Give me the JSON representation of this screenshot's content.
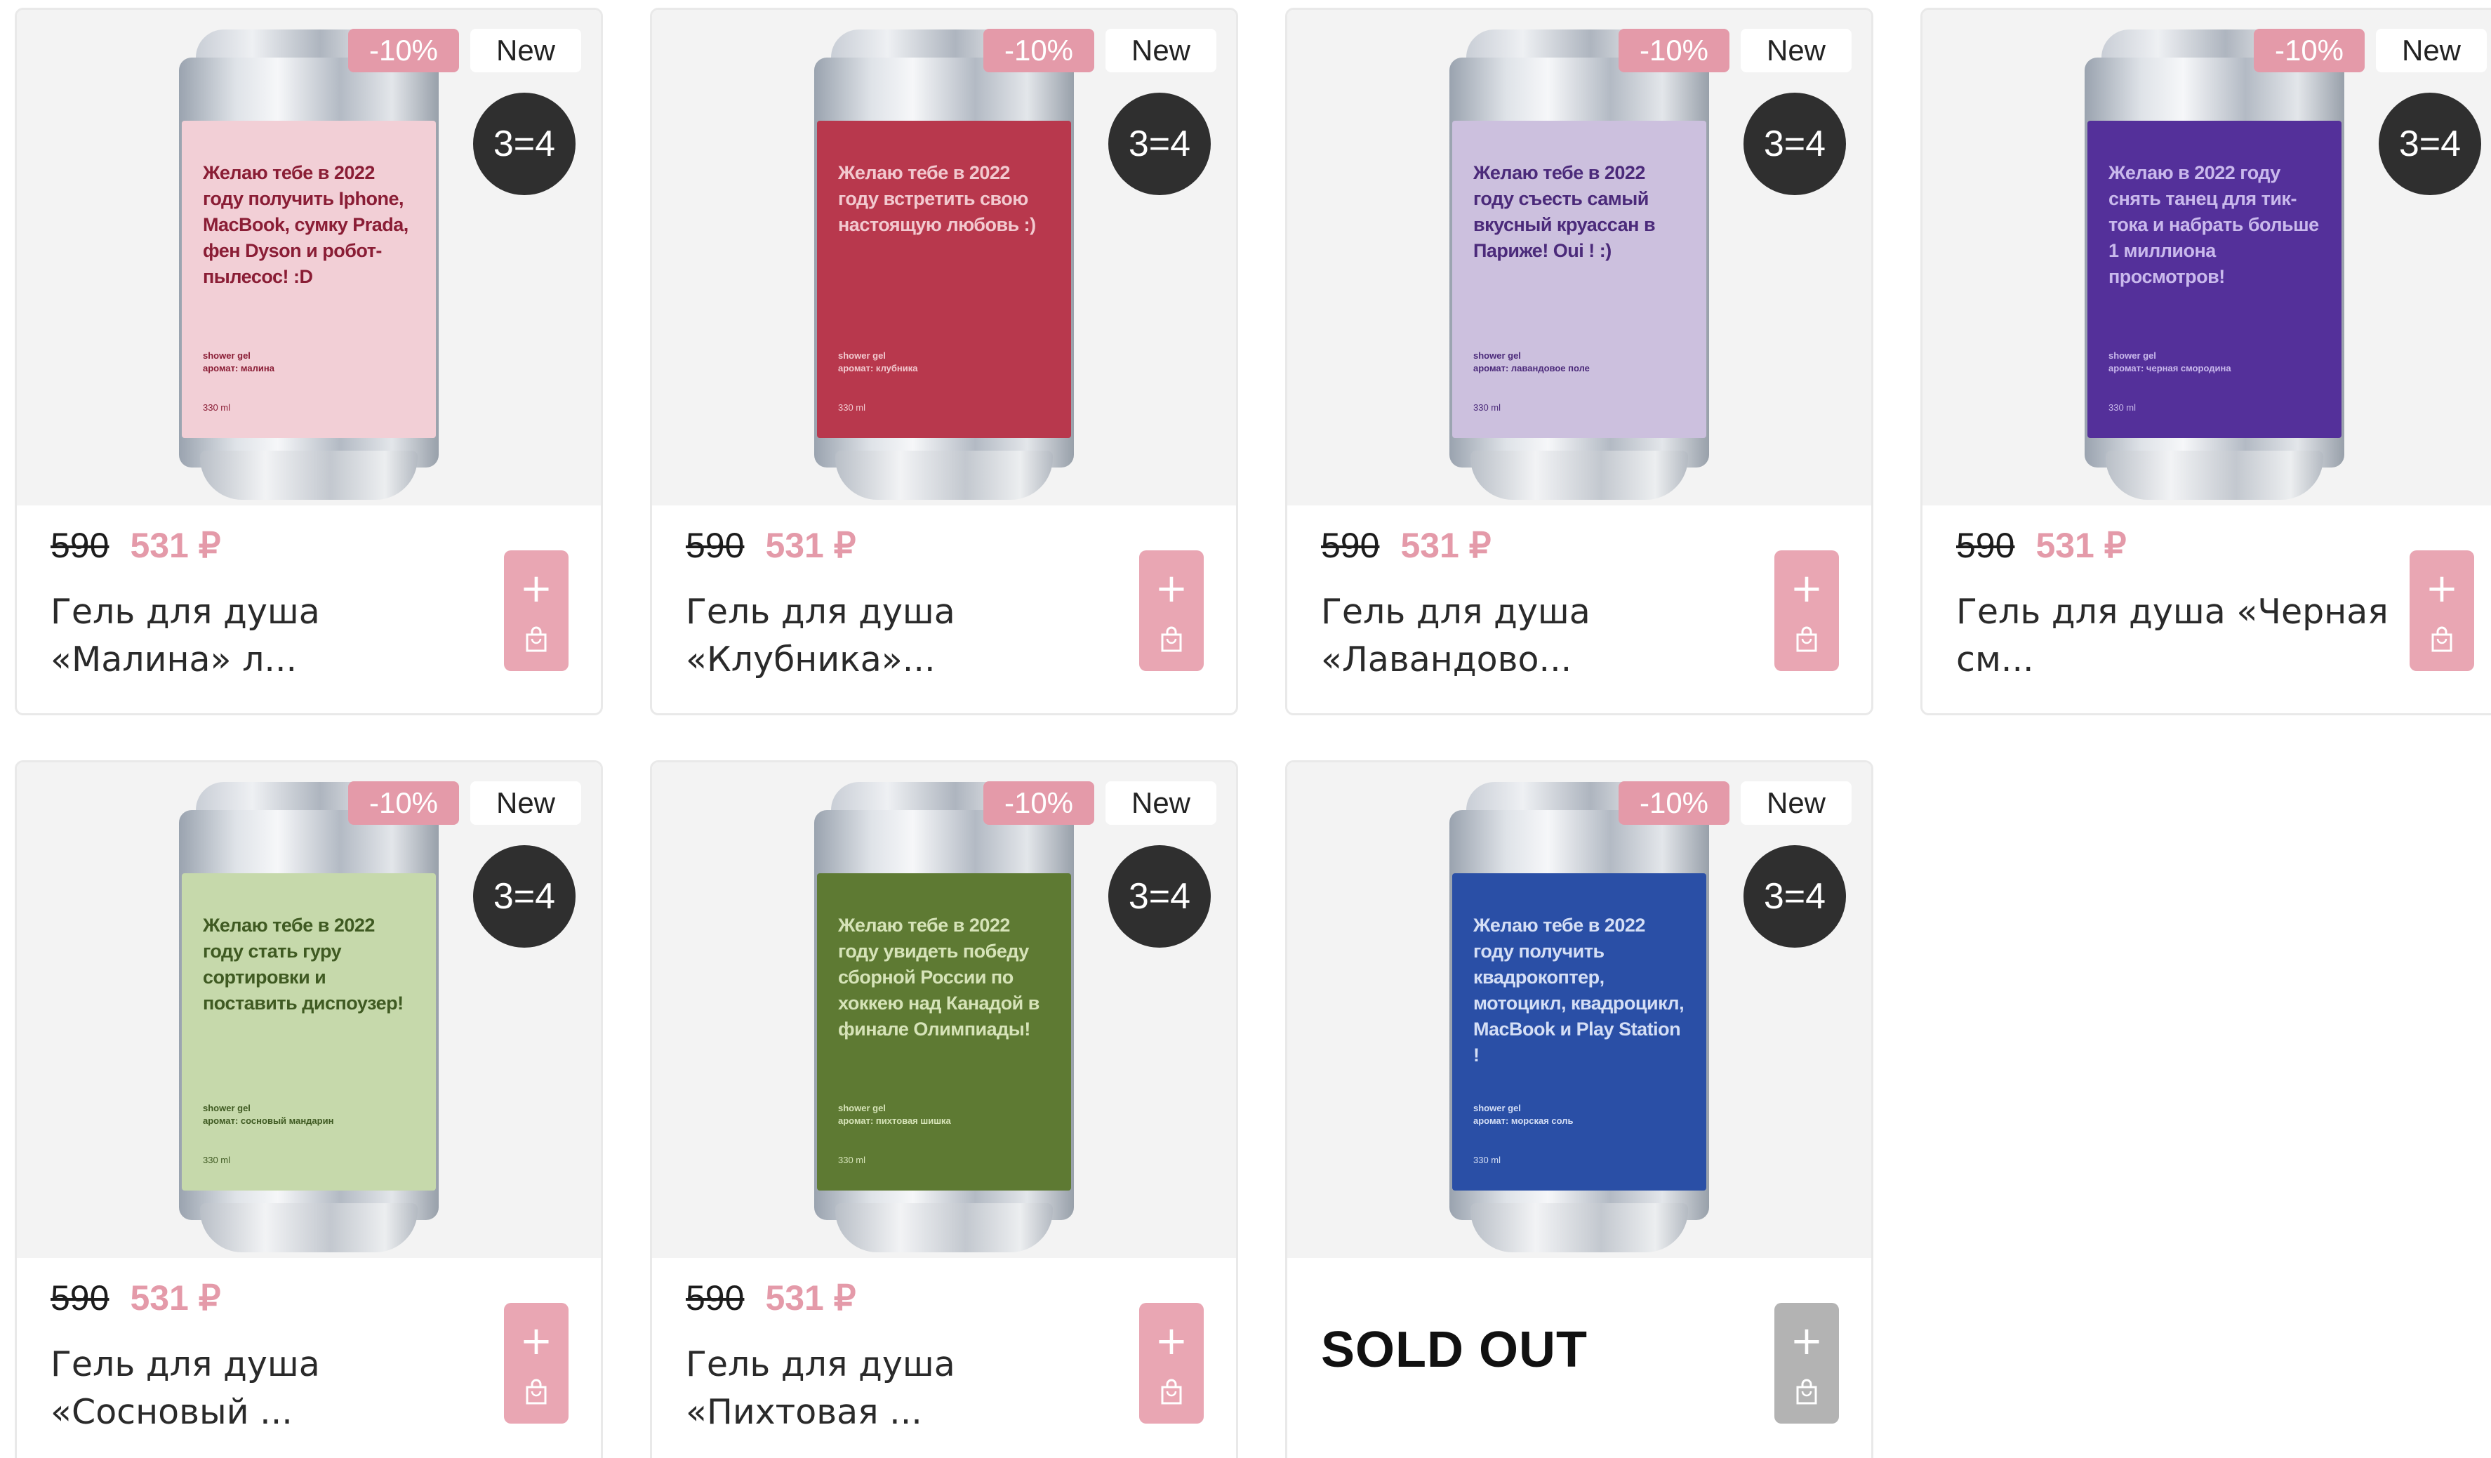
{
  "products": [
    {
      "discount_badge": "-10%",
      "new_badge": "New",
      "promo_badge": "3=4",
      "label_color": "#f2cfd6",
      "text_color": "#8a1d35",
      "can_text": "Желаю тебе в 2022 году получить Iphone, MacBook, сумку Prada, фен Dyson и робот-пылесос! :D",
      "can_meta": "shower gel\nаромат: малина",
      "can_volume": "330 ml",
      "old_price": "590",
      "new_price": "531 ₽",
      "name": "Гель для душа «Малина» л...",
      "sold_out": "",
      "cart_enabled": true
    },
    {
      "discount_badge": "-10%",
      "new_badge": "New",
      "promo_badge": "3=4",
      "label_color": "#b8384d",
      "text_color": "#f2c9cf",
      "can_text": "Желаю тебе в 2022 году встретить свою настоящую любовь :)",
      "can_meta": "shower gel\nаромат: клубника",
      "can_volume": "330 ml",
      "old_price": "590",
      "new_price": "531 ₽",
      "name": "Гель для душа «Клубника»...",
      "sold_out": "",
      "cart_enabled": true
    },
    {
      "discount_badge": "-10%",
      "new_badge": "New",
      "promo_badge": "3=4",
      "label_color": "#ccc0de",
      "text_color": "#4b2a7a",
      "can_text": "Желаю тебе в 2022 году съесть самый вкусный круассан в Париже! Oui ! :)",
      "can_meta": "shower gel\nаромат: лавандовое поле",
      "can_volume": "330 ml",
      "old_price": "590",
      "new_price": "531 ₽",
      "name": "Гель для душа «Лавандово...",
      "sold_out": "",
      "cart_enabled": true
    },
    {
      "discount_badge": "-10%",
      "new_badge": "New",
      "promo_badge": "3=4",
      "label_color": "#54309a",
      "text_color": "#c9b9ec",
      "can_text": "Желаю в 2022 году снять танец для тик-тока и набрать больше 1 миллиона просмотров!",
      "can_meta": "shower gel\nаромат: черная смородина",
      "can_volume": "330 ml",
      "old_price": "590",
      "new_price": "531 ₽",
      "name": "Гель для душа «Черная см...",
      "sold_out": "",
      "cart_enabled": true
    },
    {
      "discount_badge": "-10%",
      "new_badge": "New",
      "promo_badge": "3=4",
      "label_color": "#c6d9ab",
      "text_color": "#3f5a22",
      "can_text": "Желаю тебе в 2022 году стать гуру сортировки и поставить диспоузер!",
      "can_meta": "shower gel\nаромат: сосновый мандарин",
      "can_volume": "330 ml",
      "old_price": "590",
      "new_price": "531 ₽",
      "name": "Гель для душа «Сосновый ...",
      "sold_out": "",
      "cart_enabled": true
    },
    {
      "discount_badge": "-10%",
      "new_badge": "New",
      "promo_badge": "3=4",
      "label_color": "#5e7a33",
      "text_color": "#d6e3b8",
      "can_text": "Желаю тебе в 2022 году увидеть победу сборной России по хоккею над Канадой в финале Олимпиады!",
      "can_meta": "shower gel\nаромат: пихтовая шишка",
      "can_volume": "330 ml",
      "old_price": "590",
      "new_price": "531 ₽",
      "name": "Гель для душа «Пихтовая ...",
      "sold_out": "",
      "cart_enabled": true
    },
    {
      "discount_badge": "-10%",
      "new_badge": "New",
      "promo_badge": "3=4",
      "label_color": "#2a4fa6",
      "text_color": "#d4def5",
      "can_text": "Желаю тебе в 2022 году получить квадрокоптер, мотоцикл, квадроцикл, MacBook и Play Station !",
      "can_meta": "shower gel\nаромат: морская соль",
      "can_volume": "330 ml",
      "old_price": "",
      "new_price": "",
      "name": "",
      "sold_out": "SOLD OUT",
      "cart_enabled": false
    }
  ]
}
